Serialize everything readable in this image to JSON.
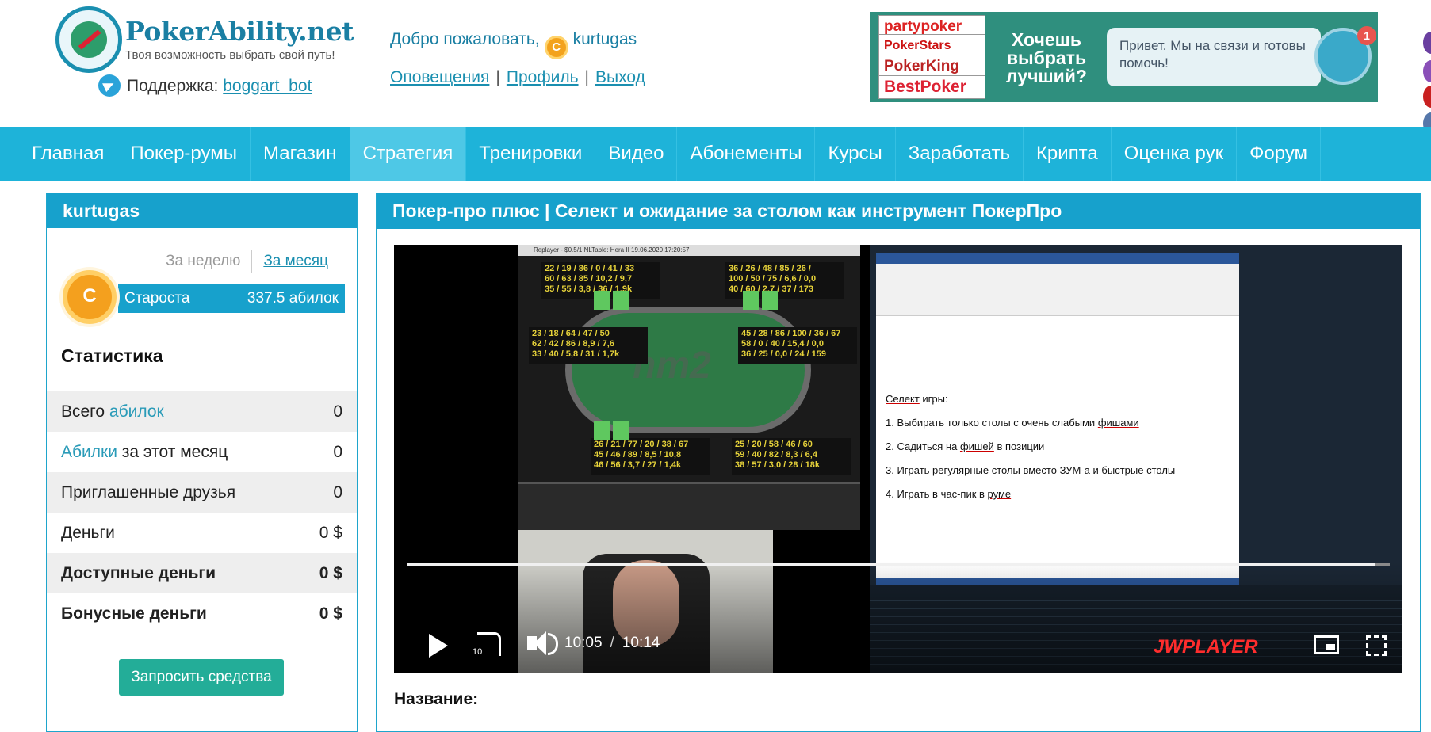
{
  "header": {
    "logo_title": "PokerAbility.net",
    "logo_slogan": "Твоя возможность выбрать свой путь!",
    "support_label": "Поддержка:",
    "support_link": "boggart_bot",
    "welcome_text": "Добро пожаловать,",
    "username": "kurtugas",
    "coin_symbol": "C",
    "links": [
      "Оповещения",
      "Профиль",
      "Выход"
    ]
  },
  "banner": {
    "rooms": [
      "partypoker",
      "PokerStars",
      "PokerKing",
      "BestPoker"
    ],
    "headline": "Хочешь выбрать лучший?",
    "chat_text": "Привет. Мы на связи и готовы помочь!",
    "chat_badge": "1"
  },
  "nav": {
    "items": [
      "Главная",
      "Покер-румы",
      "Магазин",
      "Стратегия",
      "Тренировки",
      "Видео",
      "Абонементы",
      "Курсы",
      "Заработать",
      "Крипта",
      "Оценка рук",
      "Форум"
    ],
    "active": "Стратегия"
  },
  "sidebar": {
    "username": "kurtugas",
    "period_week": "За неделю",
    "period_month": "За месяц",
    "rank_name": "Староста",
    "rank_value": "337.5 абилок",
    "stats_title": "Статистика",
    "stats": [
      {
        "label_a": "Всего ",
        "label_b": "абилок",
        "value": "0"
      },
      {
        "label_a": "Абилки",
        "label_b": " за этот месяц",
        "value": "0"
      },
      {
        "label": "Приглашенные друзья",
        "value": "0"
      },
      {
        "label": "Деньги",
        "value": "0 $"
      },
      {
        "label": "Доступные деньги",
        "value": "0 $"
      },
      {
        "label": "Бонусные деньги",
        "value": "0 $"
      }
    ],
    "withdraw_button": "Запросить средства"
  },
  "main": {
    "title": "Покер-про плюс | Селект и ожидание за столом как инструмент ПокерПро",
    "name_label": "Название:"
  },
  "video": {
    "current_time": "10:05",
    "duration": "10:14",
    "progress": 0.985,
    "rewind_seconds": "10",
    "player_brand": "JWPLAYER",
    "replayer_title": "Replayer - $0.5/1 NLTable: Hera II  19.06.2020 17:20:57",
    "hm_logo": "hm2",
    "word_lines": [
      {
        "pre": "",
        "u": "Селект",
        "post": " игры:"
      },
      {
        "pre": "1. Выбирать только столы с очень слабыми ",
        "u": "фишами",
        "post": ""
      },
      {
        "pre": "2. Садиться на ",
        "u": "фишей",
        "post": " в позиции"
      },
      {
        "pre": "3. Играть регулярные столы вместо ",
        "u": "ЗУМ-а",
        "post": " и быстрые столы"
      },
      {
        "pre": "4. Играть в час-пик в ",
        "u": "руме",
        "post": ""
      }
    ],
    "hud": [
      "22 / 19 / 86 / 0 / 41 / 33\n60 / 63 / 85 / 10,2 / 9,7\n35 / 55 / 3,8 / 36 / 1,9k",
      "36 / 26 / 48 / 85 / 26 /\n100 / 50 / 75 / 6,6 / 0,0\n40 / 60 / 2,7 / 37 / 173",
      "23 / 18 / 64 / 47 / 50\n62 / 42 / 86 / 8,9 / 7,6\n33 / 40 / 5,8 / 31 / 1,7k",
      "45 / 28 / 86 / 100 / 36 / 67\n58 / 0 / 40 / 15,4 / 0,0\n36 / 25 / 0,0 / 24 / 159",
      "26 / 21 / 77 / 20 / 38 / 67\n45 / 46 / 89 / 8,5 / 10,8\n46 / 56 / 3,7 / 27 / 1,4k",
      "25 / 20 / 58 / 46 / 60\n59 / 40 / 82 / 8,3 / 6,4\n38 / 57 / 3,0 / 28 / 18k"
    ]
  },
  "colors": {
    "brand": "#17a1cc",
    "nav": "#1eb3d9",
    "nav_active": "#4ec8e6",
    "button": "#23ad98",
    "jw_red": "#ff2d2d"
  }
}
